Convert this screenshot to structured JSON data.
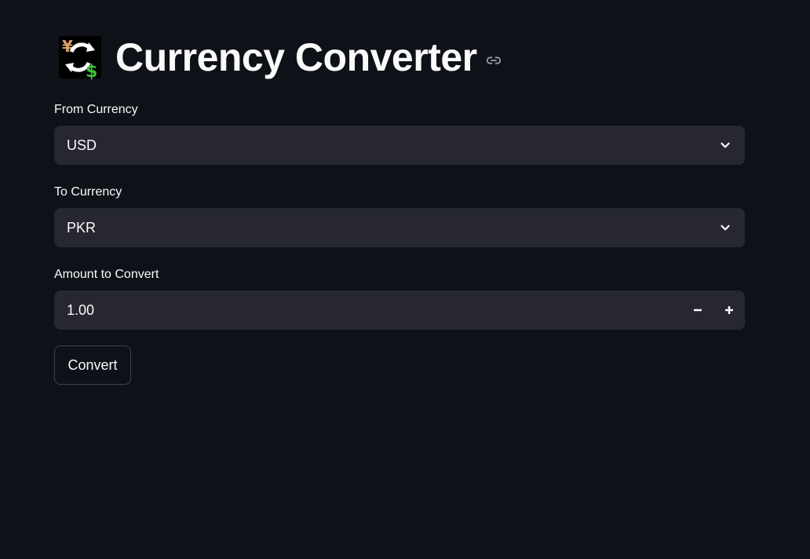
{
  "header": {
    "title": "Currency Converter",
    "title_icon": "currency-exchange-icon",
    "anchor_icon": "link-icon"
  },
  "from_currency": {
    "label": "From Currency",
    "value": "USD",
    "icon": "chevron-down-icon"
  },
  "to_currency": {
    "label": "To Currency",
    "value": "PKR",
    "icon": "chevron-down-icon"
  },
  "amount": {
    "label": "Amount to Convert",
    "value": "1.00",
    "decrement_icon": "minus-icon",
    "increment_icon": "plus-icon"
  },
  "convert_button": {
    "label": "Convert"
  },
  "colors": {
    "background": "#0e1117",
    "input_background": "#262730",
    "text": "#fafafa",
    "button_border": "#41444c"
  }
}
